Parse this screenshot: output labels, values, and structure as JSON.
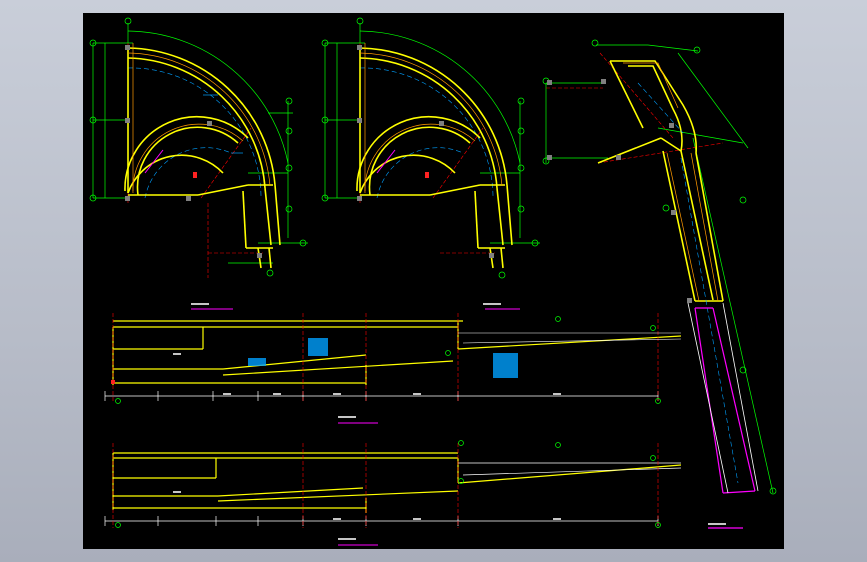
{
  "viewport": {
    "background": "#000000",
    "colors": {
      "wall": "#ffff00",
      "wall_inner": "#ff9900",
      "dimension": "#00ff00",
      "axis": "#ff0000",
      "centerline": "#00a0ff",
      "highlight": "#ff00ff",
      "grid_node": "#808080",
      "text": "#ffffff"
    },
    "drawings": [
      {
        "id": "plan-1"
      },
      {
        "id": "plan-2"
      },
      {
        "id": "plan-3"
      },
      {
        "id": "section-1"
      },
      {
        "id": "section-2"
      }
    ]
  }
}
